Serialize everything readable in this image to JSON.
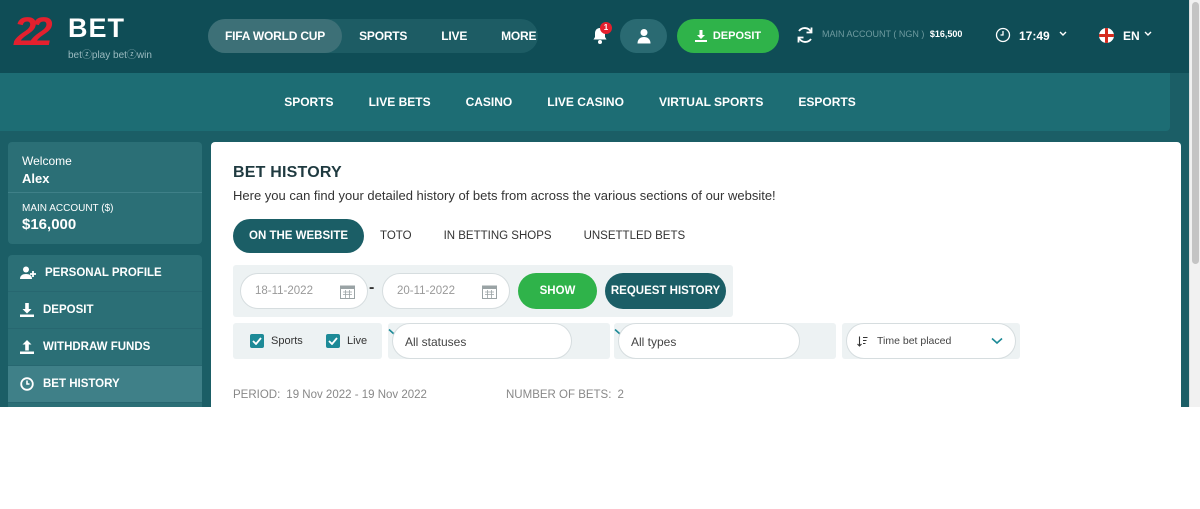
{
  "brand": {
    "digits": "22",
    "name": "BET",
    "tagline": "betⓩplay  betⓩwin"
  },
  "colors": {
    "header": "#0f4d56",
    "accent_green": "#2fb34a",
    "teal": "#1b5e66",
    "red": "#e4202e"
  },
  "header": {
    "nav": [
      {
        "label": "FIFA WORLD CUP",
        "active": true
      },
      {
        "label": "SPORTS",
        "active": false
      },
      {
        "label": "LIVE",
        "active": false
      },
      {
        "label": "MORE",
        "active": false
      }
    ],
    "notifications_count": "1",
    "deposit_label": "DEPOSIT",
    "account_label": "MAIN ACCOUNT",
    "account_currency": "( NGN )",
    "account_balance": "$16,500",
    "time": "17:49",
    "language": "EN"
  },
  "subnav": [
    "SPORTS",
    "LIVE BETS",
    "CASINO",
    "LIVE CASINO",
    "VIRTUAL SPORTS",
    "ESPORTS"
  ],
  "sidebar": {
    "welcome": "Welcome",
    "username": "Alex",
    "account_label": "MAIN ACCOUNT ($)",
    "account_amount": "$16,000",
    "menu": [
      {
        "label": "PERSONAL PROFILE",
        "icon": "user-plus-icon",
        "active": false
      },
      {
        "label": "DEPOSIT",
        "icon": "download-icon",
        "active": false
      },
      {
        "label": "WITHDRAW FUNDS",
        "icon": "upload-icon",
        "active": false
      },
      {
        "label": "BET HISTORY",
        "icon": "clock-icon",
        "active": true
      }
    ]
  },
  "main": {
    "title": "BET HISTORY",
    "subtitle": "Here you can find your detailed history of bets from across the various sections of our website!",
    "tabs": [
      {
        "label": "ON THE WEBSITE",
        "active": true
      },
      {
        "label": "TOTO",
        "active": false
      },
      {
        "label": "IN BETTING SHOPS",
        "active": false
      },
      {
        "label": "UNSETTLED BETS",
        "active": false
      }
    ],
    "date_from": "18-11-2022",
    "date_to": "20-11-2022",
    "date_separator": "-",
    "show_label": "SHOW",
    "request_label": "REQUEST HISTORY",
    "filters": {
      "sports_label": "Sports",
      "sports_checked": true,
      "live_label": "Live",
      "live_checked": true,
      "status_value": "All statuses",
      "type_value": "All types",
      "sort_value": "Time bet placed"
    },
    "period_label": "PERIOD:",
    "period_value": "19 Nov 2022 - 19 Nov 2022",
    "num_bets_label": "NUMBER OF BETS:",
    "num_bets_value": "2"
  }
}
